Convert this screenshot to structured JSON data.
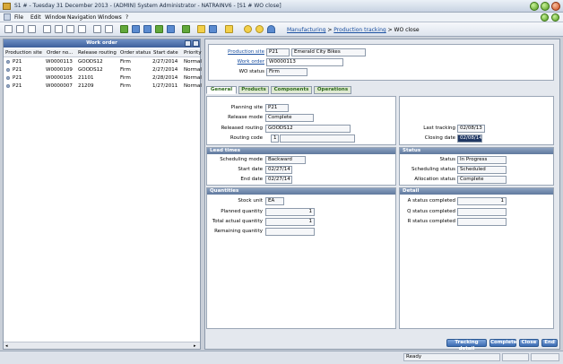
{
  "window": {
    "title": "S1 # - Tuesday 31 December 2013 - (ADMIN) System Administrator - NATRAINV6 - [S1 # WO close]"
  },
  "menu": {
    "items": [
      "File",
      "Edit",
      "Window",
      "Navigation",
      "Windows",
      "?"
    ]
  },
  "breadcrumb": {
    "part1": "Manufacturing",
    "sep1": " > ",
    "part2": "Production tracking",
    "sep2": " > ",
    "part3": "WO close"
  },
  "work_order_list": {
    "title": "Work order",
    "columns": [
      "Production site",
      "Order no...",
      "Release routing",
      "Order status",
      "Start date",
      "Priority"
    ],
    "rows": [
      [
        "P21",
        "W0000113",
        "GOODS12",
        "Firm",
        "2/27/2014",
        "Normal"
      ],
      [
        "P21",
        "W0000109",
        "GOODS12",
        "Firm",
        "2/27/2014",
        "Normal"
      ],
      [
        "P21",
        "W0000105",
        "21101",
        "Firm",
        "2/28/2014",
        "Normal"
      ],
      [
        "P21",
        "W0000007",
        "21209",
        "Firm",
        "1/27/2011",
        "Normal"
      ]
    ]
  },
  "header": {
    "production_site_label": "Production site",
    "production_site": "P21",
    "production_site_name": "Emerald City Bikes",
    "work_order_label": "Work order",
    "work_order": "W0000113",
    "wo_status_label": "WO status",
    "wo_status": "Firm"
  },
  "tabs": [
    "General",
    "Products",
    "Components",
    "Operations"
  ],
  "general": {
    "planning_site_label": "Planning site",
    "planning_site": "P21",
    "release_mode_label": "Release mode",
    "release_mode": "Complete",
    "released_routing_label": "Released routing",
    "released_routing": "GOODS12",
    "routing_code_label": "Routing code",
    "routing_code": "1",
    "last_tracking_label": "Last tracking",
    "last_tracking": "02/08/13",
    "closing_date_label": "Closing date",
    "closing_date": "02/08/14"
  },
  "lead_times": {
    "title": "Lead times",
    "scheduling_mode_label": "Scheduling mode",
    "scheduling_mode": "Backward",
    "start_date_label": "Start date",
    "start_date": "02/27/14",
    "end_date_label": "End date",
    "end_date": "02/27/14"
  },
  "status": {
    "title": "Status",
    "status_label": "Status",
    "status": "In Progress",
    "scheduling_status_label": "Scheduling status",
    "scheduling_status": "Scheduled",
    "allocation_status_label": "Allocation status",
    "allocation_status": "Complete"
  },
  "quantities": {
    "title": "Quantities",
    "stock_unit_label": "Stock unit",
    "stock_unit": "EA",
    "planned_qty_label": "Planned quantity",
    "planned_qty": "1",
    "total_actual_qty_label": "Total actual quantity",
    "total_actual_qty": "1",
    "remaining_qty_label": "Remaining quantity",
    "remaining_qty": ""
  },
  "detail": {
    "title": "Detail",
    "a_status_label": "A status completed",
    "a_status": "1",
    "q_status_label": "Q status completed",
    "q_status": "",
    "r_status_label": "R status completed",
    "r_status": ""
  },
  "actions": [
    "Tracking detail",
    "Complete",
    "Close",
    "End"
  ],
  "statusbar": {
    "text": "Ready"
  },
  "colors": {
    "header_blue": "#3d5f9c",
    "tab_green": "#2d6a1a",
    "button_blue": "#3c6bb2"
  }
}
